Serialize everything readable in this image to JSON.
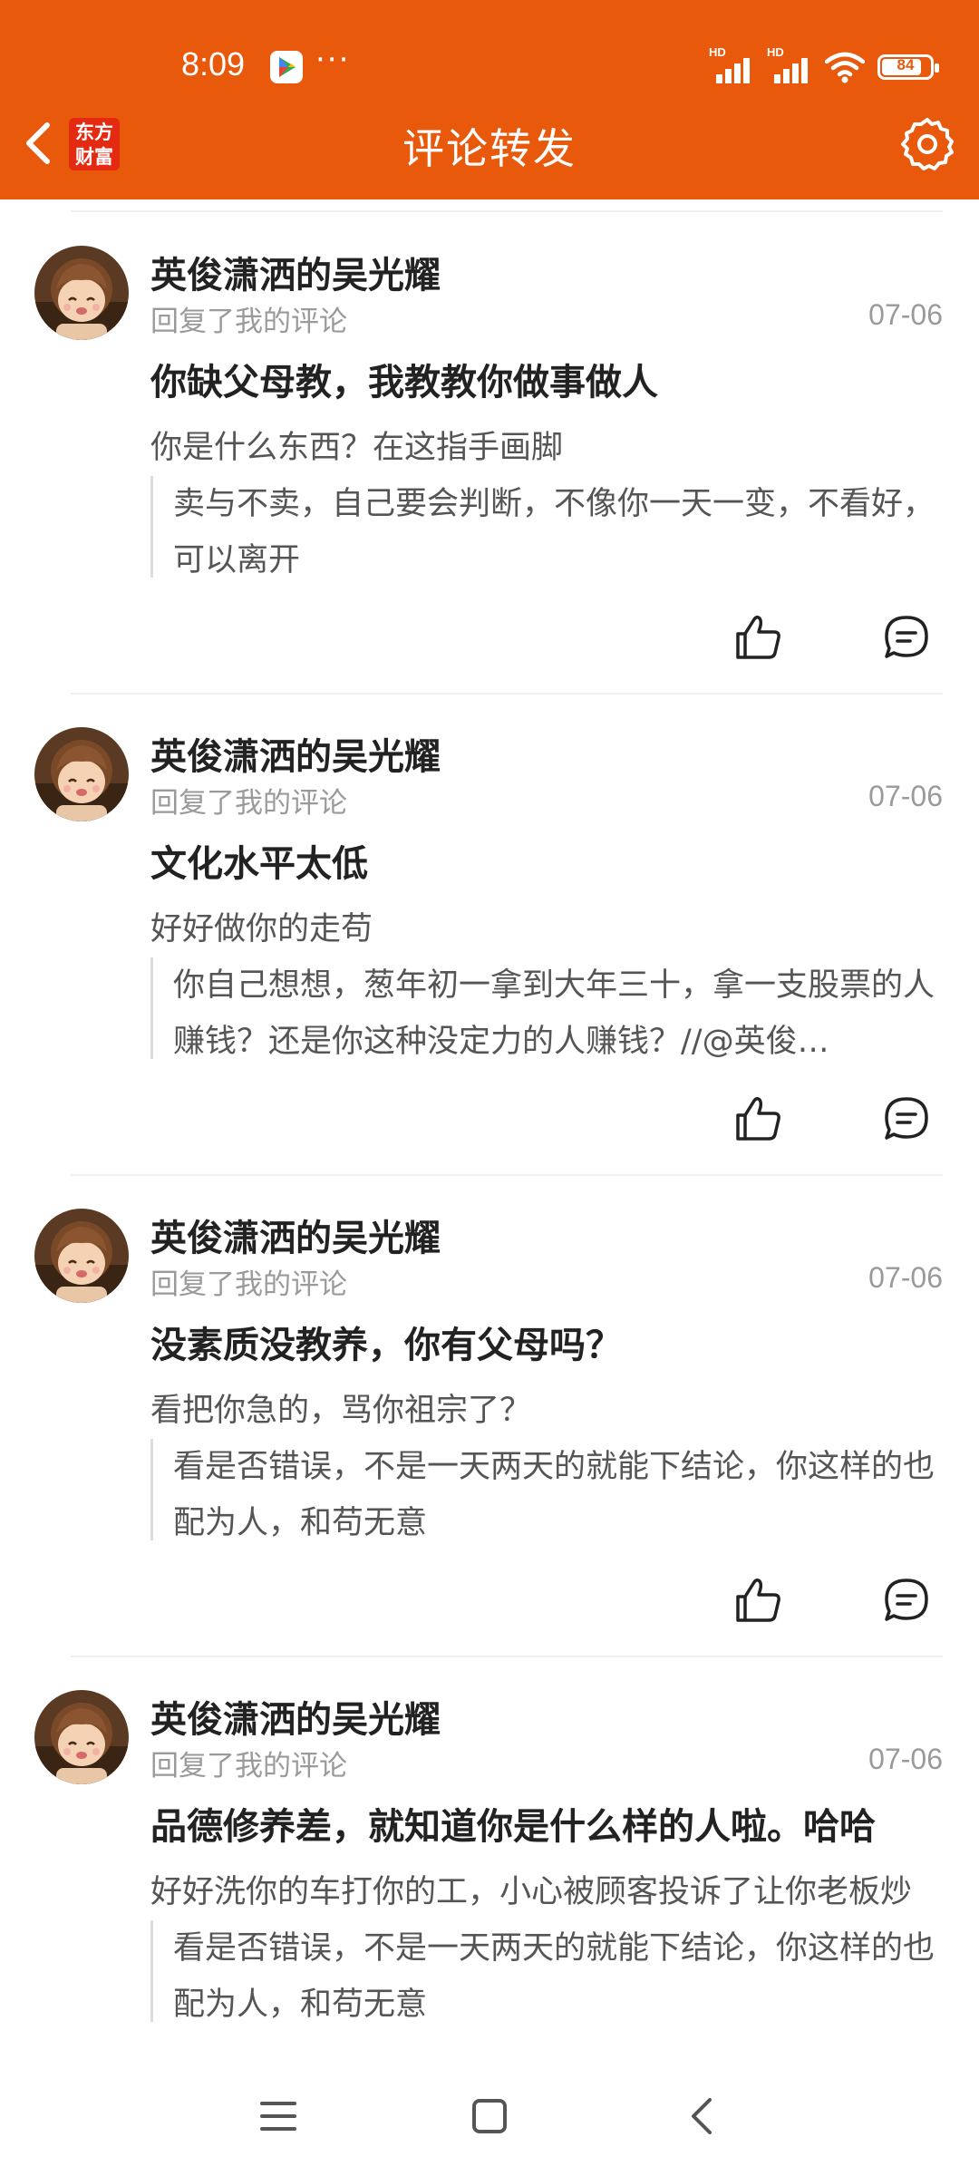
{
  "status_bar": {
    "time": "8:09",
    "dots": "···",
    "signal_hd_1": "HD",
    "signal_hd_2": "HD",
    "battery": "84"
  },
  "header": {
    "title": "评论转发",
    "logo_line1": "东方",
    "logo_line2": "财富"
  },
  "colors": {
    "header_bg": "#e8590c",
    "logo_bg": "#e52a12"
  },
  "comments": [
    {
      "author": "英俊潇洒的吴光耀",
      "action": "回复了我的评论",
      "date": "07-06",
      "title": "你缺父母教，我教教你做事做人",
      "reply": "你是什么东西？在这指手画脚",
      "quote": "卖与不卖，自己要会判断，不像你一天一变，不看好，可以离开"
    },
    {
      "author": "英俊潇洒的吴光耀",
      "action": "回复了我的评论",
      "date": "07-06",
      "title": "文化水平太低",
      "reply": "好好做你的走苟",
      "quote": "你自己想想，葱年初一拿到大年三十，拿一支股票的人赚钱？还是你这种没定力的人赚钱？//@英俊…"
    },
    {
      "author": "英俊潇洒的吴光耀",
      "action": "回复了我的评论",
      "date": "07-06",
      "title": "没素质没教养，你有父母吗？",
      "reply": "看把你急的，骂你祖宗了？",
      "quote": "看是否错误，不是一天两天的就能下结论，你这样的也配为人，和苟无意"
    },
    {
      "author": "英俊潇洒的吴光耀",
      "action": "回复了我的评论",
      "date": "07-06",
      "title": "品德修养差，就知道你是什么样的人啦。哈哈",
      "reply": "好好洗你的车打你的工，小心被顾客投诉了让你老板炒",
      "quote": "看是否错误，不是一天两天的就能下结论，你这样的也配为人，和苟无意"
    }
  ],
  "icons": {
    "back": "chevron-left-icon",
    "settings": "gear-icon",
    "like": "thumbs-up-icon",
    "comment": "comment-bubble-icon",
    "nav_menu": "menu-icon",
    "nav_home": "home-square-icon",
    "nav_back": "back-triangle-icon"
  }
}
